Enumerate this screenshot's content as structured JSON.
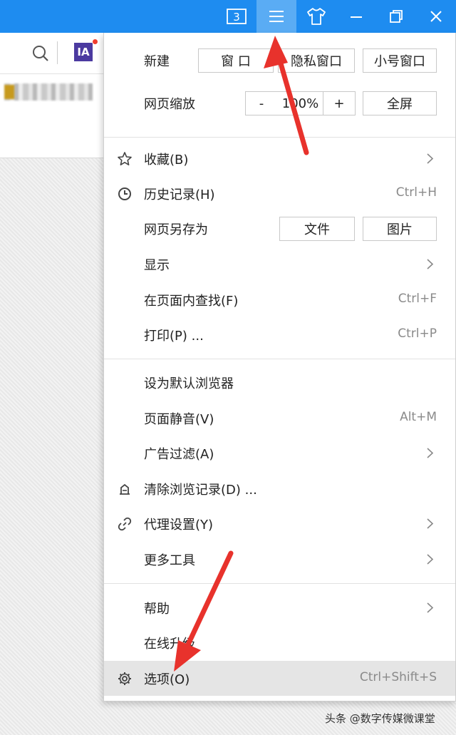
{
  "titlebar": {
    "tab_count": "3",
    "buttons": [
      "tabs-counter",
      "menu",
      "skin",
      "minimize",
      "restore",
      "close"
    ]
  },
  "toolbar": {
    "extension_label": "IA"
  },
  "menu": {
    "new_label": "新建",
    "new_window": "窗 口",
    "private_window": "隐私窗口",
    "small_window": "小号窗口",
    "zoom_label": "网页缩放",
    "zoom_minus": "-",
    "zoom_value": "100%",
    "zoom_plus": "+",
    "fullscreen": "全屏",
    "items": [
      {
        "label": "收藏(B)",
        "shortcut": "",
        "icon": "star-icon",
        "submenu": true
      },
      {
        "label": "历史记录(H)",
        "shortcut": "Ctrl+H",
        "icon": "clock-icon",
        "submenu": false
      },
      {
        "label": "网页另存为",
        "shortcut": "",
        "icon": "",
        "submenu": false
      },
      {
        "label": "显示",
        "shortcut": "",
        "icon": "",
        "submenu": true
      },
      {
        "label": "在页面内查找(F)",
        "shortcut": "Ctrl+F",
        "icon": "",
        "submenu": false
      },
      {
        "label": "打印(P) ...",
        "shortcut": "Ctrl+P",
        "icon": "",
        "submenu": false
      },
      {
        "label": "设为默认浏览器",
        "shortcut": "",
        "icon": "",
        "submenu": false
      },
      {
        "label": "页面静音(V)",
        "shortcut": "Alt+M",
        "icon": "",
        "submenu": false
      },
      {
        "label": "广告过滤(A)",
        "shortcut": "",
        "icon": "",
        "submenu": true
      },
      {
        "label": "清除浏览记录(D) ...",
        "shortcut": "",
        "icon": "eraser-icon",
        "submenu": false
      },
      {
        "label": "代理设置(Y)",
        "shortcut": "",
        "icon": "link-icon",
        "submenu": true
      },
      {
        "label": "更多工具",
        "shortcut": "",
        "icon": "",
        "submenu": true
      },
      {
        "label": "帮助",
        "shortcut": "",
        "icon": "",
        "submenu": true
      },
      {
        "label": "在线升级",
        "shortcut": "",
        "icon": "",
        "submenu": false
      },
      {
        "label": "选项(O)",
        "shortcut": "Ctrl+Shift+S",
        "icon": "gear-icon",
        "submenu": false,
        "selected": true
      }
    ],
    "save_as_file": "文件",
    "save_as_image": "图片"
  },
  "watermark": "头条 @数字传媒微课堂",
  "colors": {
    "titlebar": "#1e8cf0",
    "active_button": "#5aacf4",
    "arrow": "#e8322c",
    "selected_row": "#e5e5e5"
  }
}
